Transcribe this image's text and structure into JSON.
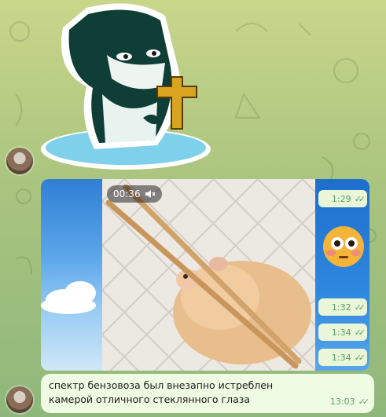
{
  "video": {
    "duration": "00:36",
    "muted_icon": "muted-speaker-icon"
  },
  "side_timestamps": [
    "1:29",
    "1:32",
    "1:34",
    "1:34"
  ],
  "message": {
    "text": "спектр бензовоза был внезапно истреблен камерой отличного стеклянного глаза",
    "time": "13:03",
    "status_icon": "double-check-icon"
  },
  "colors": {
    "wallpaper": "#a9c47f",
    "bubble": "#f0fbe3",
    "check": "#5aa067"
  }
}
